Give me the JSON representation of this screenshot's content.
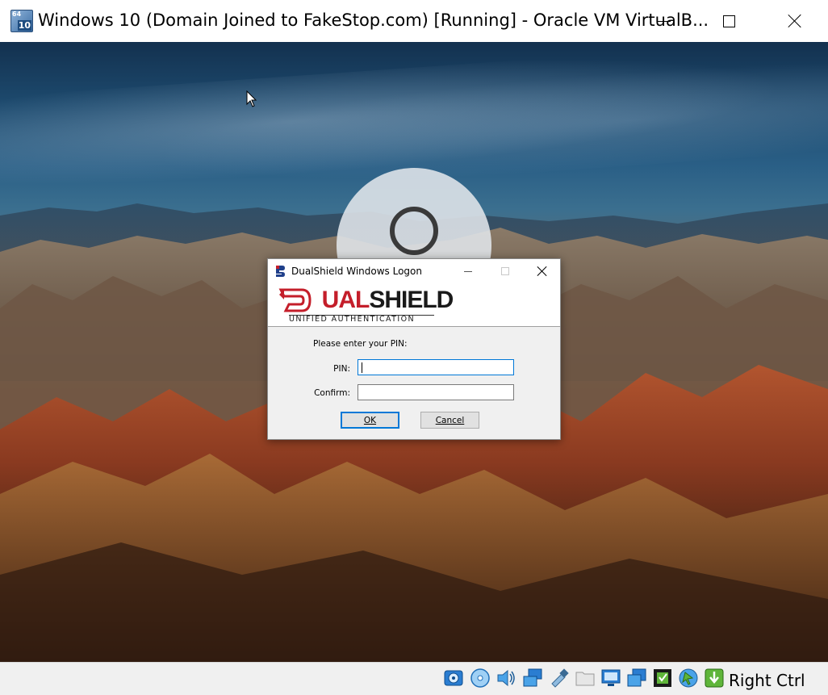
{
  "window": {
    "title": "Windows 10 (Domain Joined to FakeStop.com) [Running] - Oracle VM VirtualB...",
    "icon_badge_top": "64",
    "icon_badge_bottom": "10",
    "controls": [
      "minimize-icon",
      "maximize-icon",
      "close-icon"
    ]
  },
  "dialog": {
    "title": "DualShield Windows Logon",
    "logo": {
      "brand_part1": "D",
      "brand_part2": "UAL",
      "brand_part3": "SHIELD",
      "tagline": "UNIFIED AUTHENTICATION"
    },
    "prompt": "Please enter your PIN:",
    "pin_label": "PIN:",
    "confirm_label": "Confirm:",
    "pin_value": "",
    "confirm_value": "",
    "ok_label": "OK",
    "cancel_label": "Cancel"
  },
  "statusbar": {
    "icons": [
      "hard-disk-icon",
      "optical-drive-icon",
      "audio-icon",
      "network-icon",
      "usb-icon",
      "shared-folders-icon",
      "display-icon",
      "screen-capture-icon",
      "recording-icon",
      "mouse-integration-icon",
      "keyboard-icon"
    ],
    "host_key": "Right Ctrl"
  },
  "colors": {
    "brand_red": "#c41e2a",
    "focus_blue": "#0078d7"
  }
}
